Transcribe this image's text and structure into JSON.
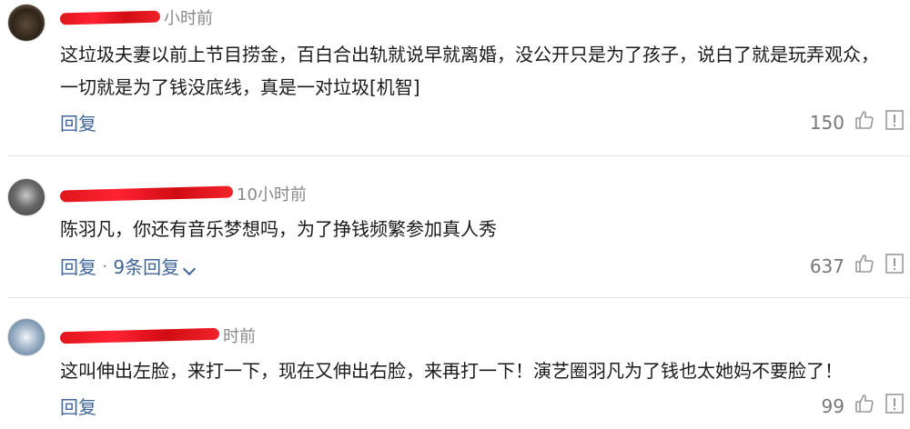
{
  "comments": [
    {
      "time": "小时前",
      "content": "这垃圾夫妻以前上节目捞金，百白合出轨就说早就离婚，没公开只是为了孩子，说白了就是玩弄观众，一切就是为了钱没底线，真是一对垃圾[机智]",
      "reply_label": "回复",
      "like_count": "150"
    },
    {
      "time": "10小时前",
      "content": "陈羽凡，你还有音乐梦想吗，为了挣钱频繁参加真人秀",
      "reply_label": "回复",
      "separator": "·",
      "replies_label": "9条回复",
      "like_count": "637"
    },
    {
      "time": "时前",
      "content": "这叫伸出左脸，来打一下，现在又伸出右脸，来再打一下！演艺圈羽凡为了钱也太她妈不要脸了！",
      "reply_label": "回复",
      "like_count": "99"
    }
  ],
  "icons": {
    "like": "thumbs-up-icon",
    "report": "report-icon",
    "expand": "chevron-down-icon"
  },
  "colors": {
    "link": "#406599",
    "redaction": "#e0151b",
    "muted": "#888888"
  }
}
